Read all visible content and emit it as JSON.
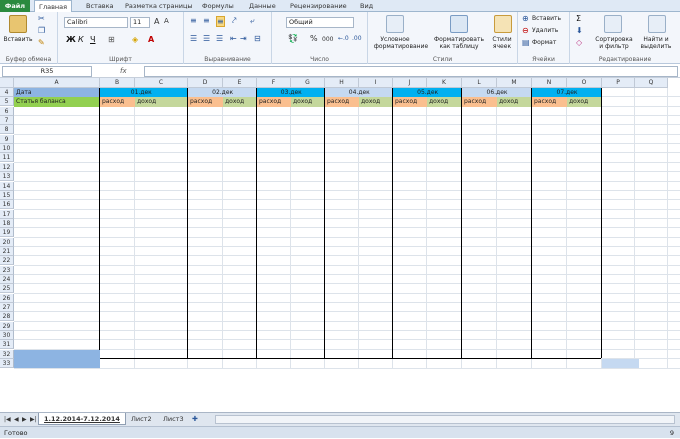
{
  "menu": {
    "file": "Файл",
    "tabs": [
      "Главная",
      "Вставка",
      "Разметка страницы",
      "Формулы",
      "Данные",
      "Рецензирование",
      "Вид"
    ]
  },
  "ribbon": {
    "clipboard": {
      "paste": "Вставить",
      "label": "Буфер обмена"
    },
    "font": {
      "name": "Calibri",
      "size": "11",
      "bold": "Ж",
      "italic": "К",
      "underline": "Ч",
      "label": "Шрифт"
    },
    "alignment": {
      "label": "Выравнивание"
    },
    "number": {
      "format": "Общий",
      "percent": "%",
      "thousands": "000",
      "label": "Число"
    },
    "styles": {
      "conditional": "Условное",
      "conditional2": "форматирование",
      "table": "Форматировать",
      "table2": "как таблицу",
      "cell": "Стили",
      "cell2": "ячеек",
      "label": "Стили"
    },
    "cells": {
      "insert": "Вставить",
      "delete": "Удалить",
      "format": "Формат",
      "label": "Ячейки"
    },
    "editing": {
      "sigma": "Σ",
      "sort": "Сортировка",
      "sort2": "и фильтр",
      "find": "Найти и",
      "find2": "выделить",
      "label": "Редактирование"
    }
  },
  "formula_bar": {
    "name_box": "R35",
    "fx": "fx",
    "value": ""
  },
  "columns": [
    "A",
    "B",
    "C",
    "D",
    "E",
    "F",
    "G",
    "H",
    "I",
    "J",
    "K",
    "L",
    "M",
    "N",
    "O",
    "P",
    "Q"
  ],
  "rows": [
    "4",
    "5",
    "6",
    "7",
    "8",
    "9",
    "10",
    "11",
    "12",
    "13",
    "14",
    "15",
    "16",
    "17",
    "18",
    "19",
    "20",
    "21",
    "22",
    "23",
    "24",
    "25",
    "26",
    "27",
    "28",
    "29",
    "30",
    "31",
    "32",
    "33"
  ],
  "row4": {
    "label": "Дата",
    "days": [
      "01.дек",
      "02.дек",
      "03.дек",
      "04.дек",
      "05.дек",
      "06.дек",
      "07.дек"
    ]
  },
  "row5": {
    "label": "Статья баланса",
    "expense": "расход",
    "income": "доход"
  },
  "sheets": [
    "1.12.2014-7.12.2014",
    "Лист2",
    "Лист3"
  ],
  "status": {
    "ready": "Готово",
    "zoom": "9"
  },
  "colors": {
    "date_row": "#00b0f0",
    "date_label": "#8db4e2",
    "header_label": "#92d050",
    "expense": "#fabf8f",
    "income": "#c4d79b",
    "selection": "#8db4e2"
  }
}
